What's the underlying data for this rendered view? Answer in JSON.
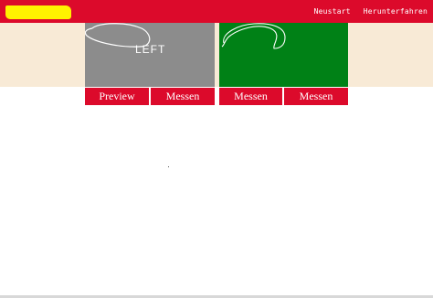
{
  "header": {
    "menu": {
      "restart": "Neustart",
      "shutdown": "Herunterfahren"
    }
  },
  "panels": {
    "left": {
      "label": "LEFT"
    }
  },
  "buttons": {
    "preview": "Preview",
    "measure_1": "Messen",
    "measure_2": "Messen",
    "measure_3": "Messen"
  },
  "colors": {
    "accent": "#dc0a2b",
    "logo": "#fff200",
    "band": "#f8ead6",
    "panel_left": "#8c8c8c",
    "panel_right": "#008116"
  }
}
